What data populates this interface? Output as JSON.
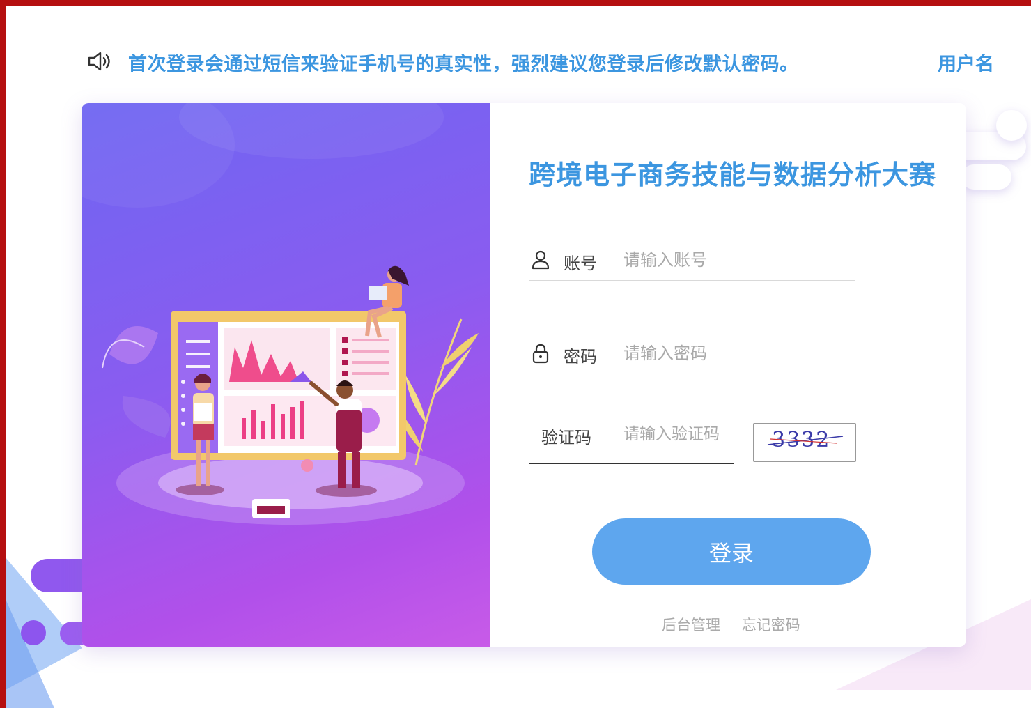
{
  "notice": {
    "text": "首次登录会通过短信来验证手机号的真实性，强烈建议您登录后修改默认密码。",
    "user_text": "用户名"
  },
  "login": {
    "title": "跨境电子商务技能与数据分析大赛",
    "account_label": "账号",
    "account_placeholder": "请输入账号",
    "password_label": "密码",
    "password_placeholder": "请输入密码",
    "captcha_label": "验证码",
    "captcha_placeholder": "请输入验证码",
    "captcha_code": "3332",
    "submit_label": "登录",
    "admin_link": "后台管理",
    "forgot_link": "忘记密码"
  },
  "colors": {
    "accent": "#3c96e0",
    "button": "#5ea6ee",
    "frame": "#b50f10",
    "panel_start": "#6e66f2",
    "panel_end": "#c85be8"
  },
  "icons": [
    "speaker-icon",
    "user-icon",
    "lock-icon"
  ]
}
